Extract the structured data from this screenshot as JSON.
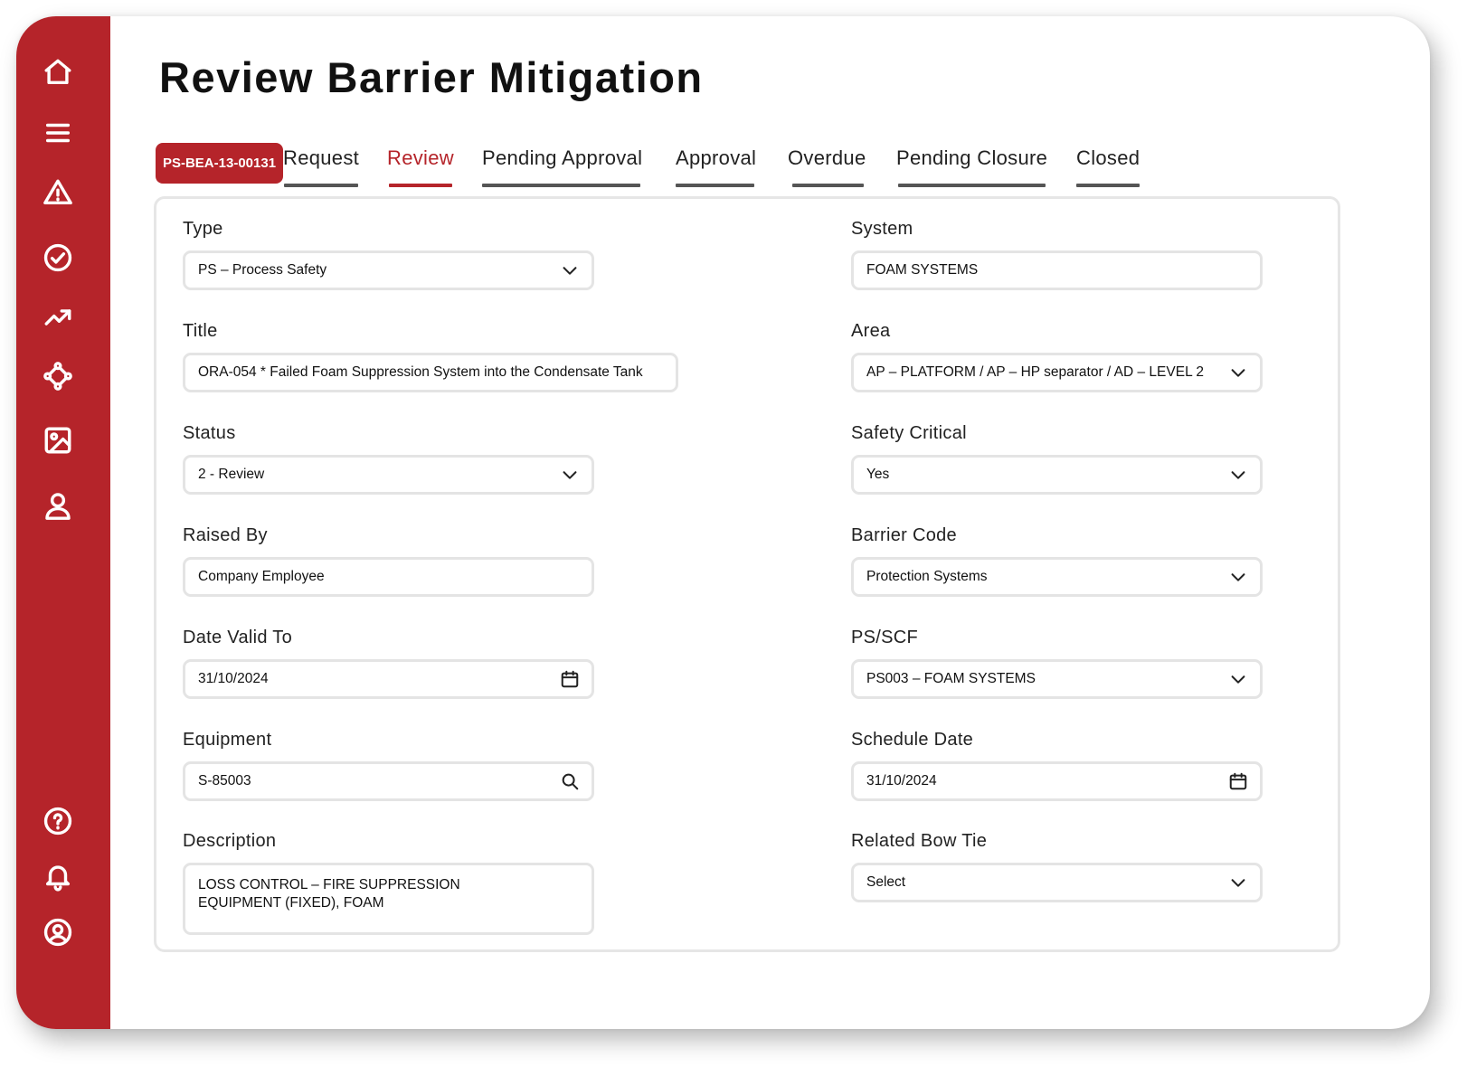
{
  "page": {
    "title": "Review Barrier Mitigation"
  },
  "record": {
    "id": "PS-BEA-13-00131"
  },
  "tabs": [
    {
      "label": "Request"
    },
    {
      "label": "Review"
    },
    {
      "label": "Pending Approval"
    },
    {
      "label": "Approval"
    },
    {
      "label": "Overdue"
    },
    {
      "label": "Pending Closure"
    },
    {
      "label": "Closed"
    }
  ],
  "active_tab": "Review",
  "sidebar": {
    "top_icons": [
      "home-icon",
      "menu-icon",
      "warning-icon",
      "check-circle-icon",
      "trending-up-icon",
      "network-icon",
      "image-icon",
      "user-icon"
    ],
    "bottom_icons": [
      "help-icon",
      "bell-icon",
      "account-circle-icon"
    ]
  },
  "form": {
    "type": {
      "label": "Type",
      "value": "PS – Process Safety"
    },
    "title": {
      "label": "Title",
      "value": "ORA-054 * Failed Foam Suppression System into the Condensate Tank"
    },
    "status": {
      "label": "Status",
      "value": "2 - Review"
    },
    "raised_by": {
      "label": "Raised By",
      "value": "Company Employee"
    },
    "date_valid_to": {
      "label": "Date Valid To",
      "value": "31/10/2024"
    },
    "equipment": {
      "label": "Equipment",
      "value": "S-85003"
    },
    "description": {
      "label": "Description",
      "value": "LOSS CONTROL – FIRE SUPPRESSION EQUIPMENT (FIXED), FOAM"
    },
    "system": {
      "label": "System",
      "value": "FOAM SYSTEMS"
    },
    "area": {
      "label": "Area",
      "value": "AP – PLATFORM / AP – HP separator / AD – LEVEL 2"
    },
    "safety_critical": {
      "label": "Safety Critical",
      "value": "Yes"
    },
    "barrier_code": {
      "label": "Barrier Code",
      "value": "Protection Systems"
    },
    "ps_scf": {
      "label": "PS/SCF",
      "value": "PS003 – FOAM SYSTEMS"
    },
    "schedule_date": {
      "label": "Schedule Date",
      "value": "31/10/2024"
    },
    "related_bow_tie": {
      "label": "Related Bow Tie",
      "value": "Select"
    }
  },
  "colors": {
    "brand": "#b5242a",
    "tab_underline": "#555555",
    "border": "#e4e4e4"
  }
}
